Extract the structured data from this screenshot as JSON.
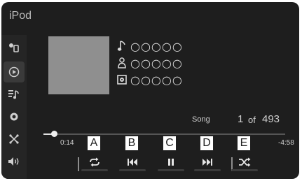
{
  "header": {
    "title": "iPod"
  },
  "sidebar": {
    "items": [
      {
        "name": "source-icon"
      },
      {
        "name": "now-playing-icon",
        "active": true
      },
      {
        "name": "playlist-icon"
      },
      {
        "name": "settings-icon"
      },
      {
        "name": "shuffle-mode-icon"
      },
      {
        "name": "volume-icon"
      }
    ]
  },
  "track": {
    "title": "○○○○○",
    "artist": "○○○○○",
    "album": "○○○○○"
  },
  "counter": {
    "label": "Song",
    "index": "1",
    "of": "of",
    "total": "493"
  },
  "progress": {
    "elapsed": "0:14",
    "remaining": "-4:58",
    "fraction": 0.045
  },
  "controls": [
    {
      "name": "repeat-icon"
    },
    {
      "name": "previous-track-icon"
    },
    {
      "name": "pause-icon"
    },
    {
      "name": "next-track-icon"
    },
    {
      "name": "shuffle-icon"
    }
  ],
  "callouts": [
    "A",
    "B",
    "C",
    "D",
    "E"
  ],
  "colors": {
    "screen": "#1e1e1e",
    "text": "#d9d9d9",
    "art": "#8f8f8f"
  }
}
